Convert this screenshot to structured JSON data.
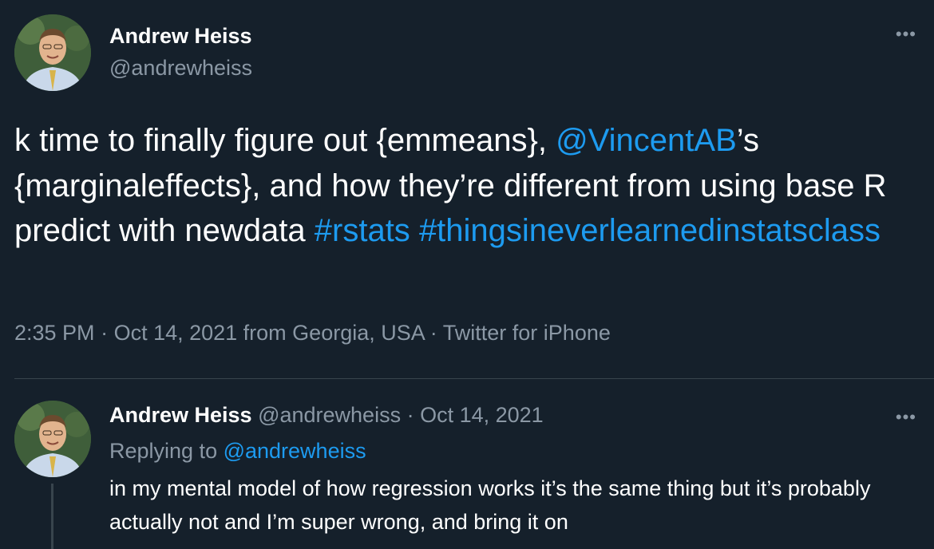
{
  "main_tweet": {
    "author_name": "Andrew Heiss",
    "author_handle": "@andrewheiss",
    "more_label": "•••",
    "text_parts": {
      "p1": "k time to finally figure out {emmeans}, ",
      "mention": "@VincentAB",
      "p2": "’s {marginaleffects}, and how they’re different from using base R predict with newdata ",
      "tag1": "#rstats",
      "space": " ",
      "tag2": "#thingsineverlearnedinstatsclass"
    },
    "time": "2:35 PM",
    "sep1": " · ",
    "date": "Oct 14, 2021",
    "location": " from Georgia, USA",
    "sep2": " · ",
    "client": "Twitter for iPhone"
  },
  "reply_tweet": {
    "author_name": "Andrew Heiss",
    "author_handle": "@andrewheiss",
    "sep": " · ",
    "date": "Oct 14, 2021",
    "more_label": "•••",
    "replying_prefix": "Replying to ",
    "replying_handle": "@andrewheiss",
    "text": "in my mental model of how regression works it’s the same thing but it’s probably actually not and I’m super wrong, and bring it on"
  },
  "colors": {
    "background": "#15202b",
    "text": "#ffffff",
    "secondary": "#8b98a5",
    "link": "#1d9bf0",
    "divider": "#38444d"
  },
  "icons": {
    "avatar": "profile-photo",
    "more": "more-options-icon"
  }
}
